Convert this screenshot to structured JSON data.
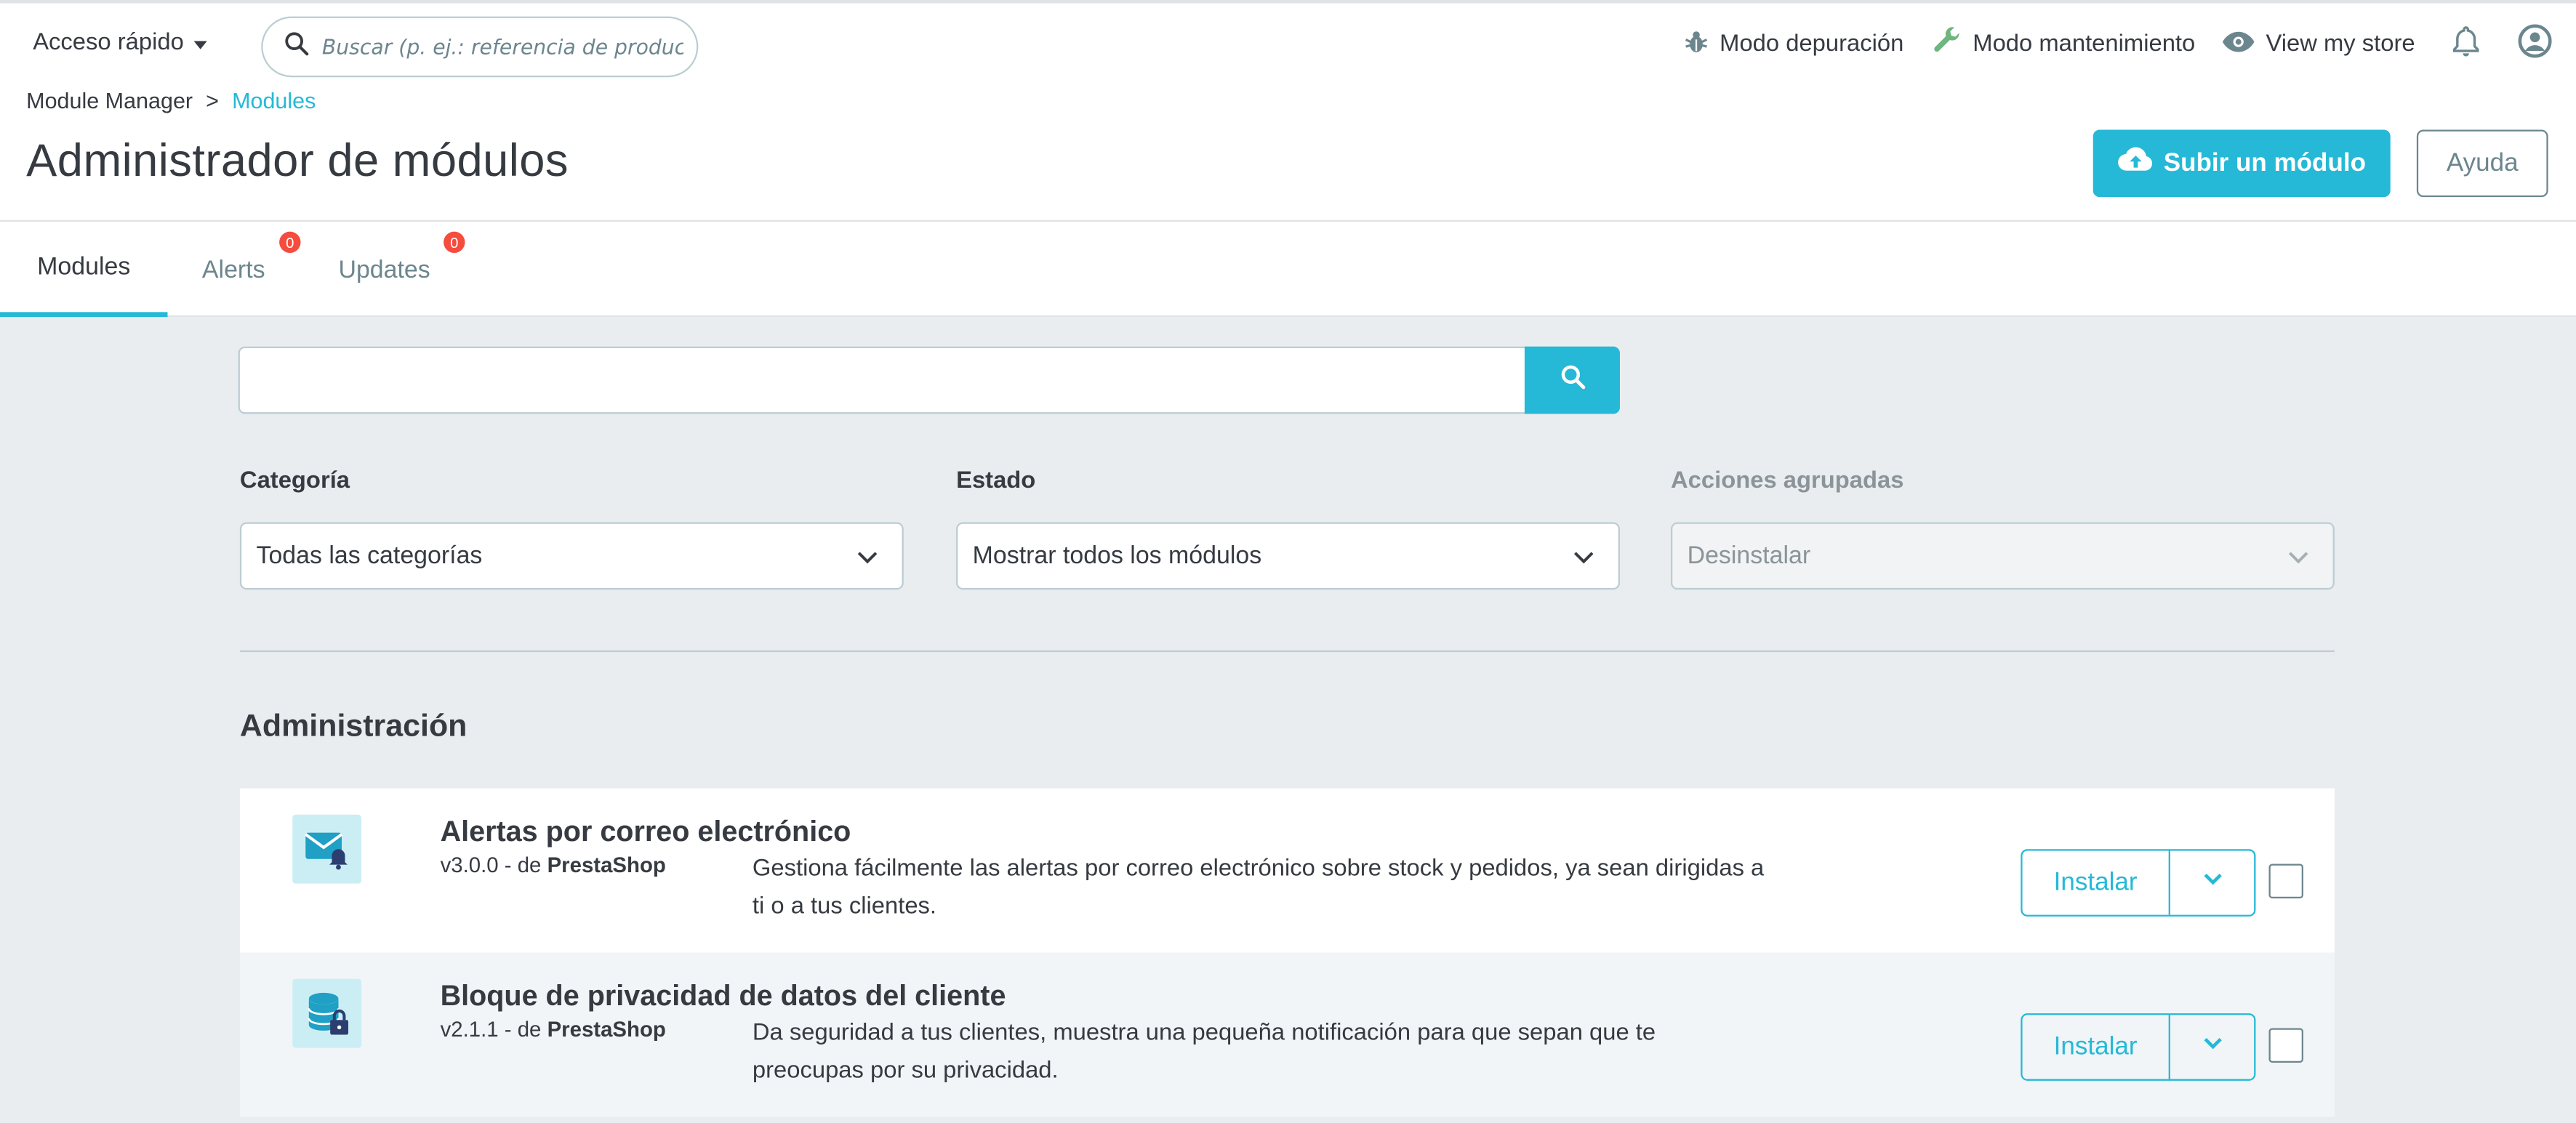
{
  "header": {
    "quick_access": "Acceso rápido",
    "search_placeholder": "Buscar (p. ej.: referencia de producto, ...",
    "debug_mode": "Modo depuración",
    "maintenance_mode": "Modo mantenimiento",
    "view_store": "View my store"
  },
  "breadcrumb": {
    "parent": "Module Manager",
    "separator": ">",
    "current": "Modules"
  },
  "page": {
    "title": "Administrador de módulos",
    "upload_button": "Subir un módulo",
    "help_button": "Ayuda"
  },
  "tabs": [
    {
      "label": "Modules",
      "active": true
    },
    {
      "label": "Alerts",
      "badge": "0"
    },
    {
      "label": "Updates",
      "badge": "0"
    }
  ],
  "filters": {
    "category_label": "Categoría",
    "category_value": "Todas las categorías",
    "status_label": "Estado",
    "status_value": "Mostrar todos los módulos",
    "bulk_label": "Acciones agrupadas",
    "bulk_value": "Desinstalar"
  },
  "section": {
    "title": "Administración"
  },
  "modules": [
    {
      "name": "Alertas por correo electrónico",
      "version": "v3.0.0 - de",
      "author": "PrestaShop",
      "description": "Gestiona fácilmente las alertas por correo electrónico sobre stock y pedidos, ya sean dirigidas a ti o a tus clientes.",
      "action": "Instalar",
      "icon": "mail-alert-icon"
    },
    {
      "name": "Bloque de privacidad de datos del cliente",
      "version": "v2.1.1 - de",
      "author": "PrestaShop",
      "description": "Da seguridad a tus clientes, muestra una pequeña notificación para que sepan que te preocupas por su privacidad.",
      "action": "Instalar",
      "icon": "database-lock-icon"
    }
  ],
  "colors": {
    "accent": "#25b9d7",
    "badge": "#f54c3e",
    "text": "#363a41",
    "muted": "#6c868e",
    "background": "#eaedf0"
  }
}
